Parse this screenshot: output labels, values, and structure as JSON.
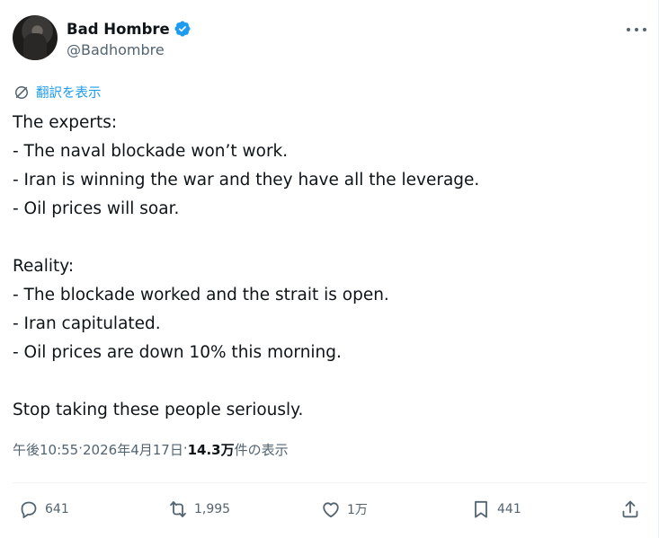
{
  "author": {
    "display_name": "Bad Hombre",
    "handle": "@Badhombre",
    "verified": true
  },
  "translate_label": "翻訳を表示",
  "tweet_lines": [
    "The experts:",
    "- The naval blockade won’t work.",
    "- Iran is winning the war and they have all the leverage.",
    "- Oil prices will soar.",
    "",
    "Reality:",
    "- The blockade worked and the strait is open.",
    "- Iran capitulated.",
    "- Oil prices are down 10% this morning.",
    "",
    "Stop taking these people seriously."
  ],
  "meta": {
    "time": "午後10:55",
    "separator": " · ",
    "date": "2026年4月17日",
    "views_count": "14.3万",
    "views_label": " 件の表示"
  },
  "actions": {
    "replies": "641",
    "reposts": "1,995",
    "likes": "1万",
    "bookmarks": "441"
  },
  "colors": {
    "accent": "#1d9bf0",
    "secondary_text": "#536471",
    "primary_text": "#0f1419"
  },
  "icons": [
    "verified-badge-icon",
    "more-icon",
    "translate-globe-icon",
    "reply-icon",
    "repost-icon",
    "like-icon",
    "bookmark-icon",
    "share-icon"
  ]
}
